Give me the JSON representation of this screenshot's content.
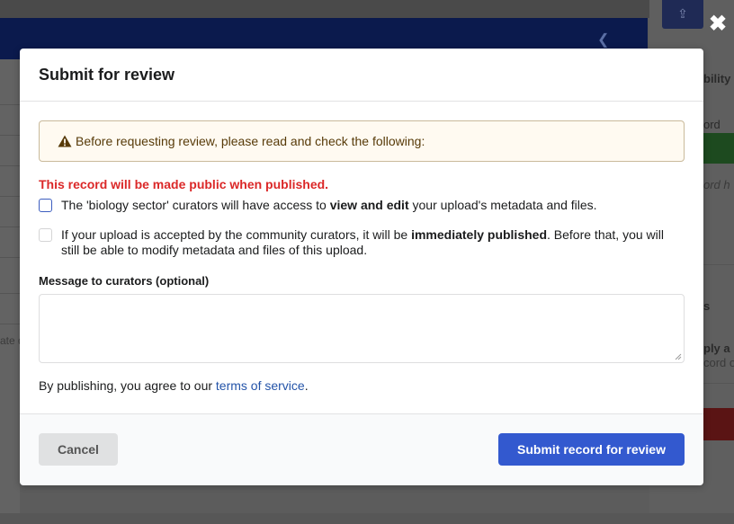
{
  "modal": {
    "title": "Submit for review",
    "warning": "Before requesting review, please read and check the following:",
    "public_notice": "This record will be made public when published.",
    "checks": [
      {
        "pre": "The 'biology sector' curators will have access to ",
        "bold": "view and edit",
        "post": " your upload's metadata and files.",
        "checked": false
      },
      {
        "pre": "If your upload is accepted by the community curators, it will be ",
        "bold": "immediately published",
        "post": ". Before that, you will still be able to modify metadata and files of this upload.",
        "checked": false
      }
    ],
    "message_label": "Message to curators (optional)",
    "message_value": "",
    "terms_prefix": "By publishing, you agree to our ",
    "terms_link": "terms of service",
    "terms_suffix": ".",
    "cancel_label": "Cancel",
    "submit_label": "Submit record for review"
  },
  "background": {
    "close_symbol": "✖",
    "right_fragments": [
      "bility",
      "ord",
      "ord h",
      "s",
      "ply a",
      "cord o"
    ],
    "left_fragment": "ate d"
  },
  "colors": {
    "primary_button": "#3359cf",
    "error_text": "#db2828",
    "warning_bg": "#fffaf1",
    "link": "#2353a8"
  },
  "icons": {
    "warning": "warning-triangle-icon",
    "close": "close-icon",
    "share": "share-icon"
  }
}
